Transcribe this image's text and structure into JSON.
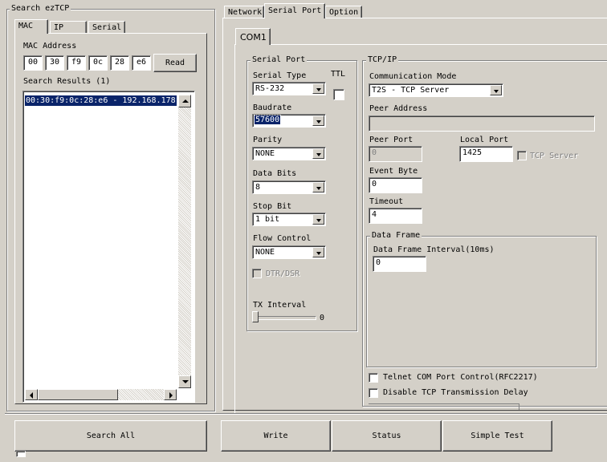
{
  "search_group": {
    "title": "Search ezTCP",
    "tabs": [
      "MAC",
      "IP",
      "Serial"
    ],
    "mac_label": "MAC Address",
    "mac_octets": [
      "00",
      "30",
      "f9",
      "0c",
      "28",
      "e6"
    ],
    "read_button": "Read",
    "results_label": "Search Results (1)",
    "results": [
      "00:30:f9:0c:28:e6 - 192.168.178."
    ]
  },
  "main_tabs": [
    "Network",
    "Serial Port",
    "Option"
  ],
  "com_tab": "COM1",
  "serial_port": {
    "title": "Serial Port",
    "serial_type_label": "Serial Type",
    "serial_type_value": "RS-232",
    "ttl_label": "TTL",
    "baudrate_label": "Baudrate",
    "baudrate_value": "57600",
    "parity_label": "Parity",
    "parity_value": "NONE",
    "data_bits_label": "Data Bits",
    "data_bits_value": "8",
    "stop_bit_label": "Stop Bit",
    "stop_bit_value": "1 bit",
    "flow_control_label": "Flow Control",
    "flow_control_value": "NONE",
    "dtr_dsr_label": "DTR/DSR",
    "tx_interval_label": "TX Interval",
    "tx_interval_value": "0",
    "tx_interval_level": 0
  },
  "tcpip": {
    "title": "TCP/IP",
    "comm_mode_label": "Communication Mode",
    "comm_mode_value": "T2S - TCP Server",
    "peer_address_label": "Peer Address",
    "peer_address_value": "",
    "peer_port_label": "Peer Port",
    "peer_port_value": "0",
    "local_port_label": "Local Port",
    "local_port_value": "1425",
    "tcp_server_label": "TCP Server",
    "event_byte_label": "Event Byte",
    "event_byte_value": "0",
    "timeout_label": "Timeout",
    "timeout_value": "4",
    "data_frame_title": "Data Frame",
    "data_frame_interval_label": "Data Frame Interval(10ms)",
    "data_frame_interval_value": "0",
    "telnet_label": "Telnet COM Port Control(RFC2217)",
    "disable_delay_label": "Disable TCP Transmission Delay"
  },
  "bottom_buttons": {
    "search_all": "Search All",
    "write": "Write",
    "status": "Status",
    "simple_test": "Simple Test"
  },
  "colors": {
    "window": "#d4d0c8",
    "selection": "#0a246a"
  }
}
